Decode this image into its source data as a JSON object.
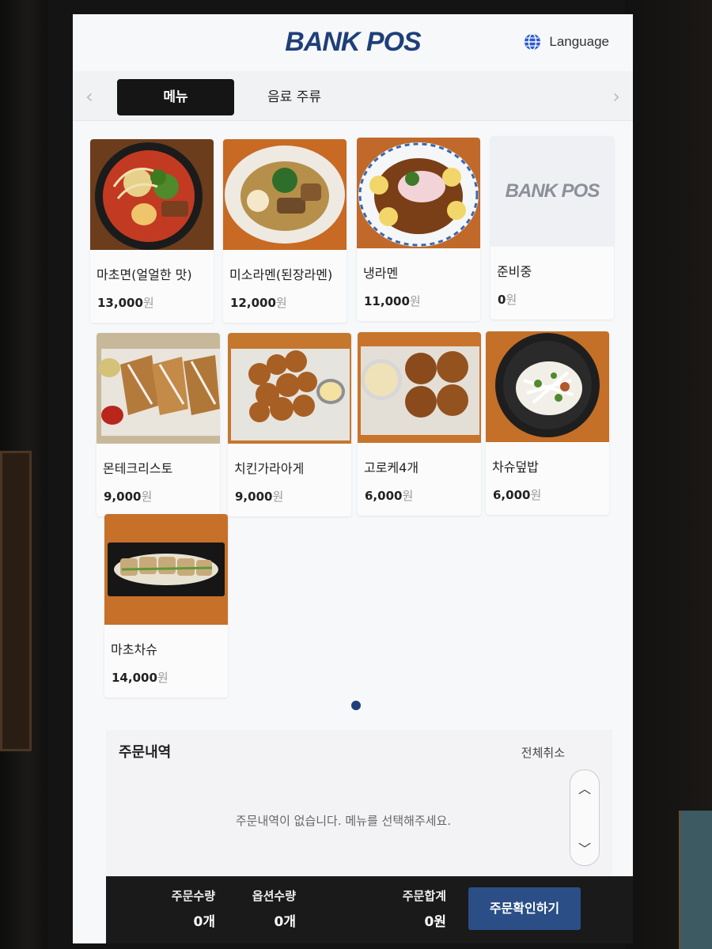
{
  "header": {
    "logo": "BANK POS",
    "language_label": "Language"
  },
  "tabs": [
    {
      "label": "메뉴",
      "active": true
    },
    {
      "label": "음료 주류",
      "active": false
    }
  ],
  "products": [
    {
      "name": "마초면(얼얼한 맛)",
      "price": "13,000",
      "currency": "원",
      "image": "spicy-ramen"
    },
    {
      "name": "미소라멘(된장라멘)",
      "price": "12,000",
      "currency": "원",
      "image": "miso-ramen"
    },
    {
      "name": "냉라멘",
      "price": "11,000",
      "currency": "원",
      "image": "cold-ramen"
    },
    {
      "name": "준비중",
      "price": "0",
      "currency": "원",
      "image": "placeholder",
      "placeholder_logo": "BANK POS"
    },
    {
      "name": "몬테크리스토",
      "price": "9,000",
      "currency": "원",
      "image": "monte-cristo"
    },
    {
      "name": "치킨가라아게",
      "price": "9,000",
      "currency": "원",
      "image": "chicken-karaage"
    },
    {
      "name": "고로케4개",
      "price": "6,000",
      "currency": "원",
      "image": "croquette"
    },
    {
      "name": "차슈덮밥",
      "price": "6,000",
      "currency": "원",
      "image": "chashu-rice-bowl"
    },
    {
      "name": "마초차슈",
      "price": "14,000",
      "currency": "원",
      "image": "macho-chashu"
    }
  ],
  "order": {
    "title": "주문내역",
    "clear_all": "전체취소",
    "empty_message": "주문내역이 없습니다. 메뉴를 선택해주세요."
  },
  "summary": {
    "order_qty_label": "주문수량",
    "order_qty": "0개",
    "option_qty_label": "옵션수량",
    "option_qty": "0개",
    "total_label": "주문합계",
    "total": "0원",
    "confirm_label": "주문확인하기"
  },
  "colors": {
    "brand": "#1f3f7a",
    "confirm": "#2b4e86",
    "active_tab": "#151515"
  }
}
